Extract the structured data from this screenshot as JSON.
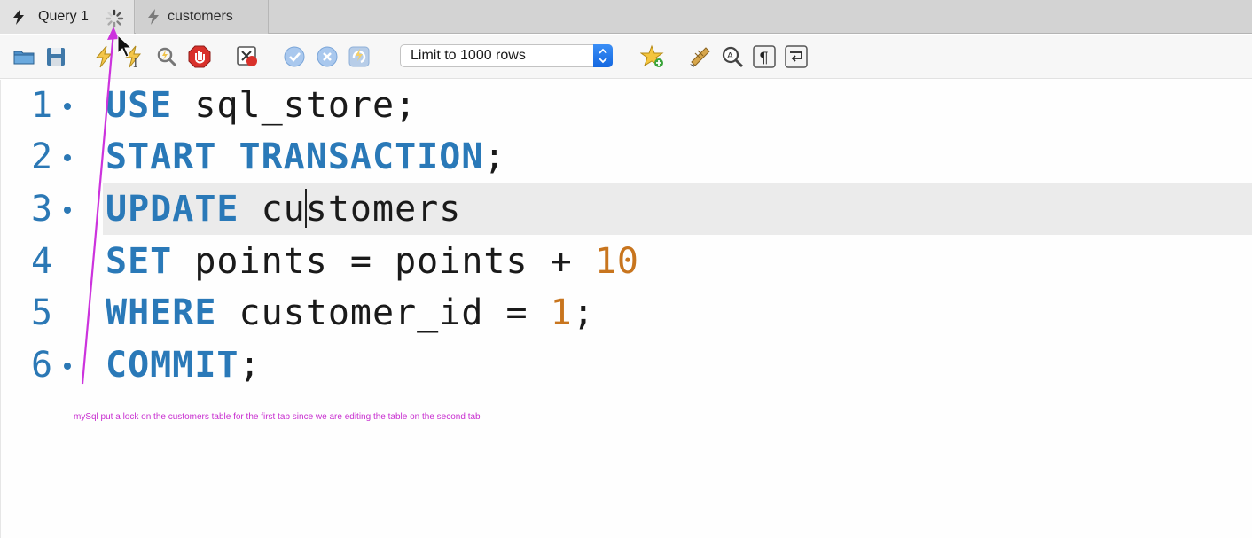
{
  "tabs": [
    {
      "label": "Query 1",
      "icon": "lightning-bolt-icon",
      "active": true,
      "loading": true
    },
    {
      "label": "customers",
      "icon": "lightning-bolt-icon",
      "active": false
    }
  ],
  "toolbar": {
    "limit_select": {
      "value": "Limit to 1000 rows"
    },
    "icons": [
      "open-folder-icon",
      "save-icon",
      "execute-icon",
      "execute-current-icon",
      "explain-icon",
      "stop-icon",
      "toggle-error-icon",
      "commit-icon",
      "rollback-icon",
      "autocommit-icon",
      "add-snippet-icon",
      "beautify-icon",
      "find-icon",
      "invisible-chars-icon",
      "word-wrap-icon"
    ]
  },
  "editor": {
    "lines": [
      {
        "number": "1",
        "has_dot": true
      },
      {
        "number": "2",
        "has_dot": true
      },
      {
        "number": "3",
        "has_dot": true,
        "current": true
      },
      {
        "number": "4",
        "has_dot": false
      },
      {
        "number": "5",
        "has_dot": false
      },
      {
        "number": "6",
        "has_dot": true
      }
    ],
    "tokens": {
      "l1_kw": "USE",
      "l1_rest": " sql_store;",
      "l2_kw": "START TRANSACTION",
      "l2_rest": ";",
      "l3_kw": "UPDATE",
      "l3_before_caret": " cu",
      "l3_after_caret": "stomers",
      "l4_kw": "SET",
      "l4_rest": " points = points + ",
      "l4_num": "10",
      "l5_kw": "WHERE",
      "l5_rest": " customer_id = ",
      "l5_num": "1",
      "l5_end": ";",
      "l6_kw": "COMMIT",
      "l6_rest": ";"
    }
  },
  "annotation": {
    "text": "mySql put a lock on the customers table for the first tab since we are editing the table on the second tab",
    "color": "#c82fd0"
  },
  "colors": {
    "keyword": "#2a79b8",
    "number": "#c8751e",
    "line_number": "#2b78b5",
    "current_line": "#ebebeb"
  }
}
